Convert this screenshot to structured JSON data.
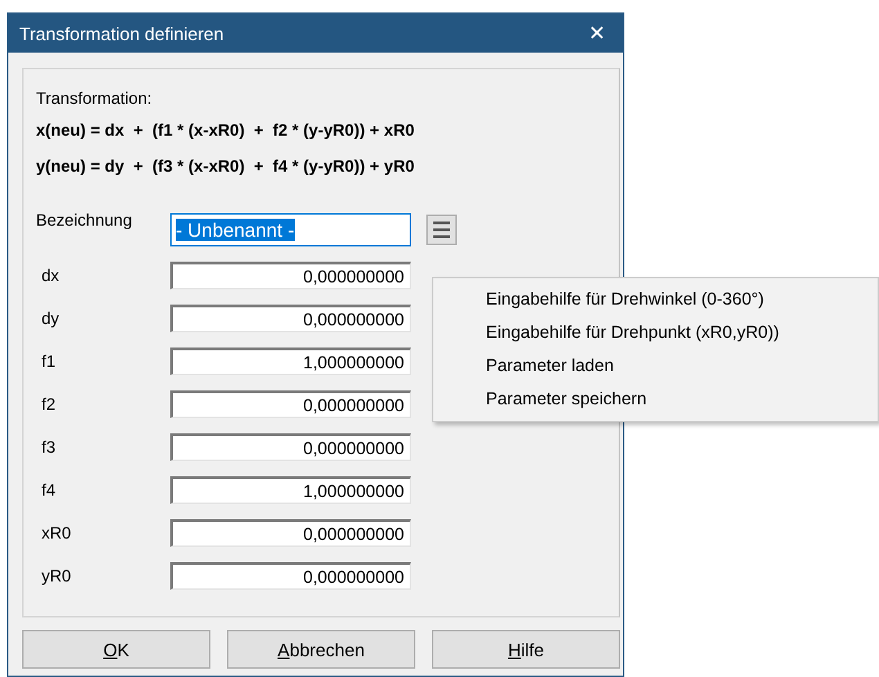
{
  "window": {
    "title": "Transformation definieren",
    "close": "✕"
  },
  "formula": {
    "heading": "Transformation:",
    "lines": [
      "x(neu) = dx  +  (f1 * (x-xR0)  +  f2 * (y-yR0)) + xR0",
      "y(neu) = dy  +  (f3 * (x-xR0)  +  f4 * (y-yR0)) + yR0"
    ]
  },
  "name_field": {
    "label": "Bezeichnung",
    "value": "- Unbenannt -",
    "focused": true,
    "value_selected": true
  },
  "parameters": [
    {
      "label": "dx",
      "value": "0,000000000"
    },
    {
      "label": "dy",
      "value": "0,000000000"
    },
    {
      "label": "f1",
      "value": "1,000000000"
    },
    {
      "label": "f2",
      "value": "0,000000000"
    },
    {
      "label": "f3",
      "value": "0,000000000"
    },
    {
      "label": "f4",
      "value": "1,000000000"
    },
    {
      "label": "xR0",
      "value": "0,000000000"
    },
    {
      "label": "yR0",
      "value": "0,000000000"
    }
  ],
  "menu": {
    "open": true,
    "items": [
      "Eingabehilfe für Drehwinkel (0-360°)",
      "Eingabehilfe für Drehpunkt (xR0,yR0))",
      "Parameter laden",
      "Parameter speichern"
    ]
  },
  "buttons": [
    {
      "key": "O",
      "rest": "K"
    },
    {
      "key": "A",
      "rest": "bbrechen"
    },
    {
      "key": "H",
      "rest": "ilfe"
    }
  ]
}
